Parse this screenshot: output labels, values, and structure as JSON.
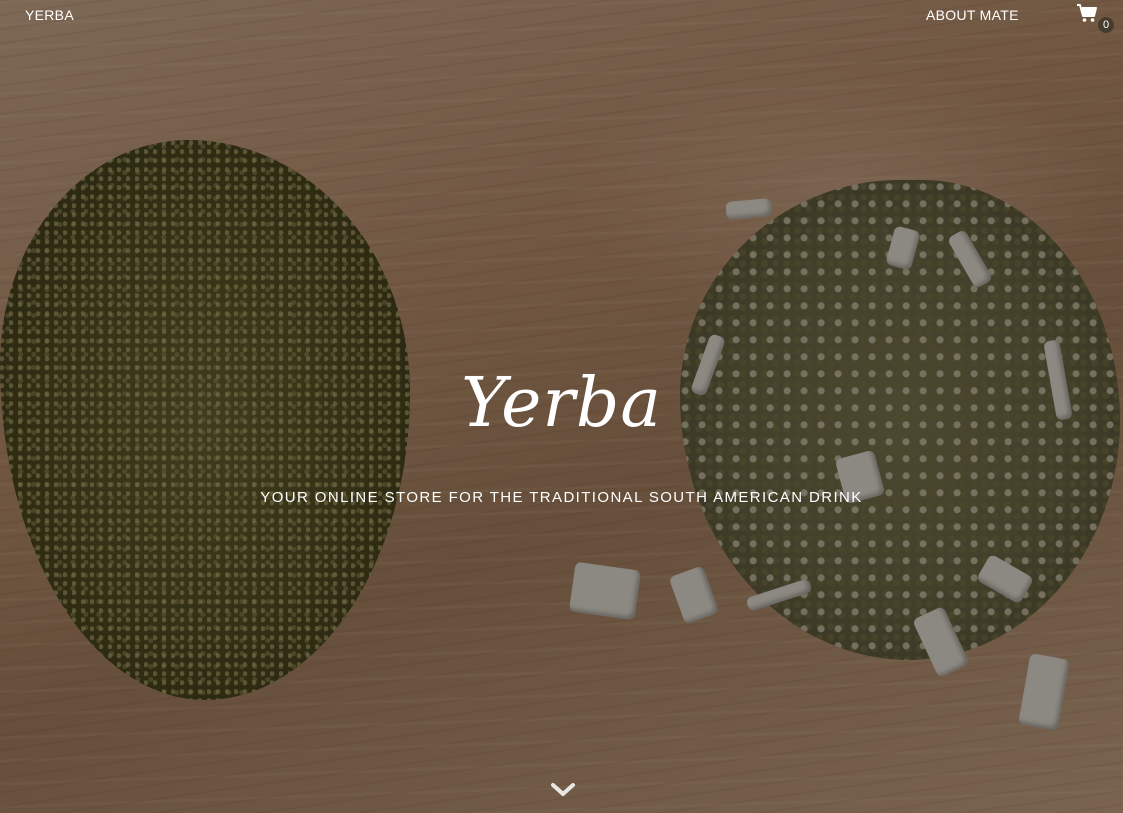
{
  "header": {
    "brand": "YERBA",
    "nav": [
      {
        "label": "ABOUT MATE"
      }
    ],
    "cart": {
      "icon": "shopping-cart-icon",
      "count": "0"
    }
  },
  "hero": {
    "title": "Yerba",
    "subtitle": "YOUR ONLINE STORE FOR THE TRADITIONAL SOUTH AMERICAN DRINK",
    "scroll_icon": "chevron-down-icon"
  }
}
